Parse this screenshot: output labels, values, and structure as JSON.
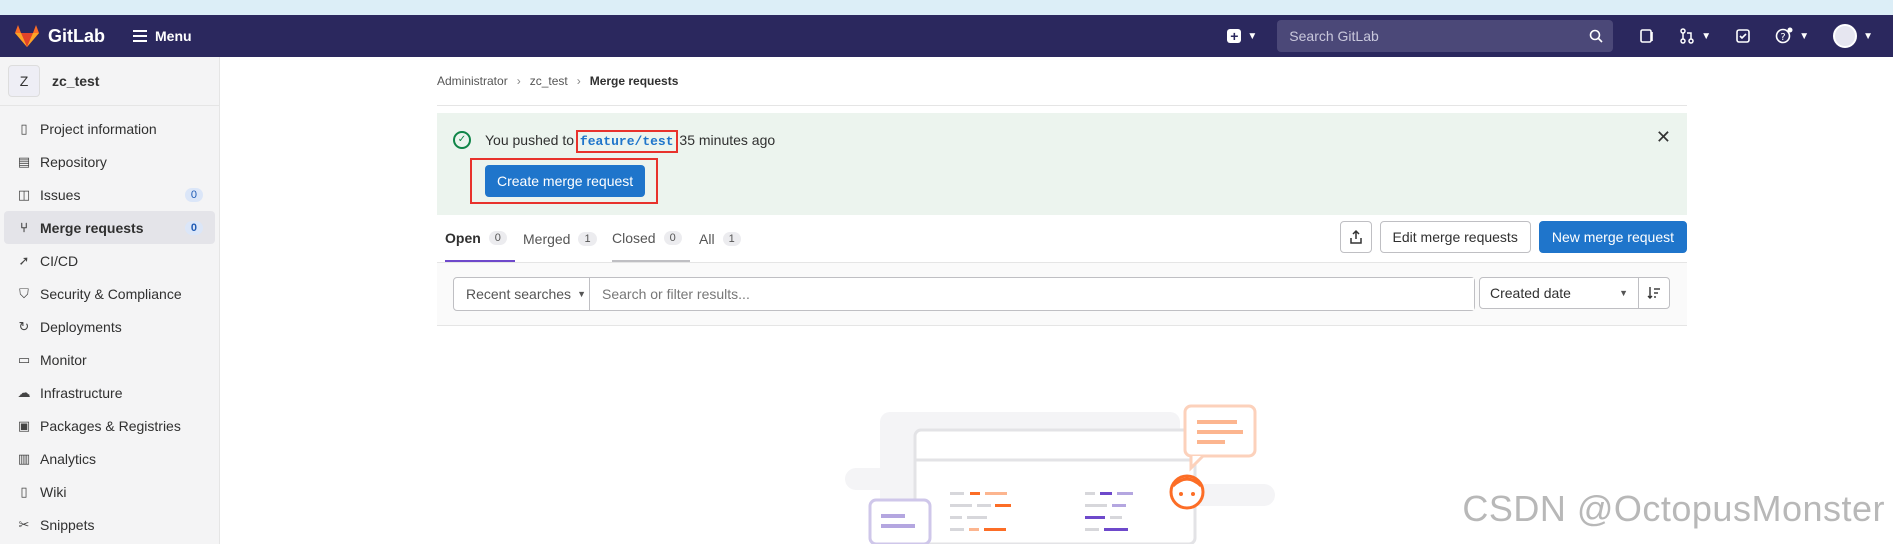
{
  "topbar": {
    "brand": "GitLab",
    "menu_label": "Menu",
    "search_placeholder": "Search GitLab"
  },
  "sidebar": {
    "project_initial": "Z",
    "project_name": "zc_test",
    "items": [
      {
        "label": "Project information",
        "icon": "info-doc-icon"
      },
      {
        "label": "Repository",
        "icon": "file-icon"
      },
      {
        "label": "Issues",
        "icon": "issues-icon",
        "badge": "0"
      },
      {
        "label": "Merge requests",
        "icon": "merge-request-icon",
        "badge": "0",
        "active": true
      },
      {
        "label": "CI/CD",
        "icon": "rocket-icon"
      },
      {
        "label": "Security & Compliance",
        "icon": "shield-icon"
      },
      {
        "label": "Deployments",
        "icon": "deployments-icon"
      },
      {
        "label": "Monitor",
        "icon": "monitor-icon"
      },
      {
        "label": "Infrastructure",
        "icon": "cloud-icon"
      },
      {
        "label": "Packages & Registries",
        "icon": "package-icon"
      },
      {
        "label": "Analytics",
        "icon": "chart-icon"
      },
      {
        "label": "Wiki",
        "icon": "book-icon"
      },
      {
        "label": "Snippets",
        "icon": "scissors-icon"
      }
    ]
  },
  "breadcrumb": {
    "items": [
      "Administrator",
      "zc_test",
      "Merge requests"
    ]
  },
  "alert": {
    "prefix": "You pushed to",
    "branch": "feature/test",
    "suffix": "35 minutes ago",
    "button": "Create merge request"
  },
  "tabs": [
    {
      "label": "Open",
      "count": "0"
    },
    {
      "label": "Merged",
      "count": "1"
    },
    {
      "label": "Closed",
      "count": "0"
    },
    {
      "label": "All",
      "count": "1"
    }
  ],
  "actions": {
    "edit": "Edit merge requests",
    "new": "New merge request"
  },
  "filter": {
    "recent": "Recent searches",
    "placeholder": "Search or filter results...",
    "sort": "Created date"
  },
  "watermark": "CSDN @OctopusMonster",
  "colors": {
    "topbar": "#2b285e",
    "primary": "#1f75cb",
    "alert_bg": "#ecf4ee",
    "highlight": "#e8322c",
    "active_tab": "#6e49cb"
  }
}
